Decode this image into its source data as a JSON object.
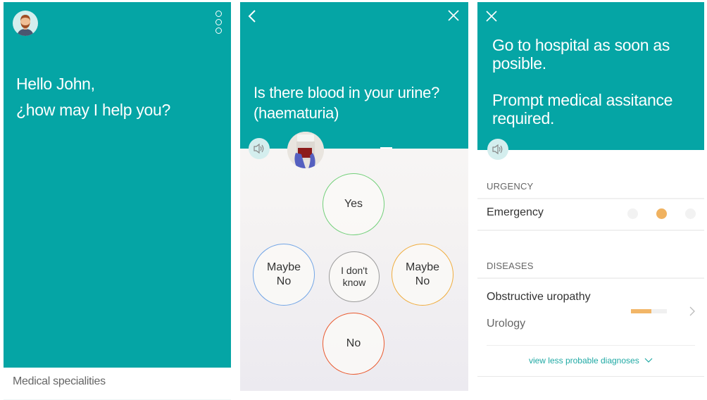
{
  "colors": {
    "teal": "#05a5a5",
    "yes": "#72d07a",
    "maybe_no_left": "#73a6e6",
    "dont_know": "#9c9c9c",
    "maybe_no_right": "#f0ad3e",
    "no": "#ea5a2f",
    "accent_orange": "#f0b260",
    "link": "#1fa9a4"
  },
  "home": {
    "avatar_icon": "user-avatar",
    "menu_icon": "vertical-dots-icon",
    "greeting_line1": "Hello John,",
    "greeting_line2": "¿how may I help you?",
    "footer_item": "Medical specialities"
  },
  "question": {
    "back_icon": "chevron-left-icon",
    "close_icon": "close-icon",
    "text_line1": "Is there blood in your urine?",
    "text_line2": "(haematuria)",
    "speaker_icon": "speaker-icon",
    "image": "urine-sample-photo",
    "answers": [
      {
        "id": "yes",
        "label_line1": "Yes",
        "label_line2": ""
      },
      {
        "id": "maybe-no-left",
        "label_line1": "Maybe",
        "label_line2": "No"
      },
      {
        "id": "dont-know",
        "label_line1": "I don't",
        "label_line2": "know"
      },
      {
        "id": "maybe-no-right",
        "label_line1": "Maybe",
        "label_line2": "No"
      },
      {
        "id": "no",
        "label_line1": "No",
        "label_line2": ""
      }
    ]
  },
  "result": {
    "close_icon": "close-icon",
    "advice_line1": "Go to hospital as soon as posible.",
    "advice_line2": "Prompt medical assitance required.",
    "speaker_icon": "speaker-icon",
    "urgency_label": "URGENCY",
    "urgency_value": "Emergency",
    "urgency_levels": 3,
    "urgency_active_level": 2,
    "diseases_label": "DISEASES",
    "diseases": [
      {
        "name": "Obstructive uropathy",
        "specialty": "Urology",
        "probability": 0.57
      }
    ],
    "view_less_link": "view less probable diagnoses"
  }
}
